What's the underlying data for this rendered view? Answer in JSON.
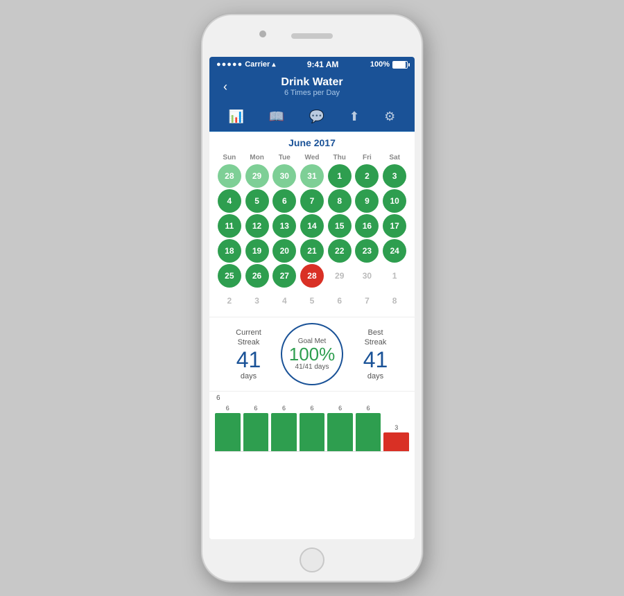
{
  "statusBar": {
    "carrier": "Carrier",
    "wifi": "WiFi",
    "time": "9:41 AM",
    "battery": "100%"
  },
  "header": {
    "title": "Drink Water",
    "subtitle": "6 Times per Day",
    "backLabel": "‹"
  },
  "toolbar": {
    "icons": [
      "chart-icon",
      "book-icon",
      "comment-icon",
      "share-icon",
      "settings-icon"
    ]
  },
  "calendar": {
    "monthLabel": "June 2017",
    "dayHeaders": [
      "Sun",
      "Mon",
      "Tue",
      "Wed",
      "Thu",
      "Fri",
      "Sat"
    ]
  },
  "stats": {
    "currentStreakLabel": "Current\nStreak",
    "currentStreakValue": "41",
    "currentStreakUnit": "days",
    "goalMetLabel": "Goal Met",
    "goalPct": "100%",
    "goalSub": "41/41 days",
    "bestStreakLabel": "Best\nStreak",
    "bestStreakValue": "41",
    "bestStreakUnit": "days"
  },
  "chart": {
    "lineValue": "6",
    "bars": [
      {
        "label": "6",
        "value": 6,
        "type": "green"
      },
      {
        "label": "6",
        "value": 6,
        "type": "green"
      },
      {
        "label": "6",
        "value": 6,
        "type": "green"
      },
      {
        "label": "6",
        "value": 6,
        "type": "green"
      },
      {
        "label": "6",
        "value": 6,
        "type": "green"
      },
      {
        "label": "6",
        "value": 6,
        "type": "green"
      },
      {
        "label": "3",
        "value": 3,
        "type": "red"
      }
    ]
  }
}
